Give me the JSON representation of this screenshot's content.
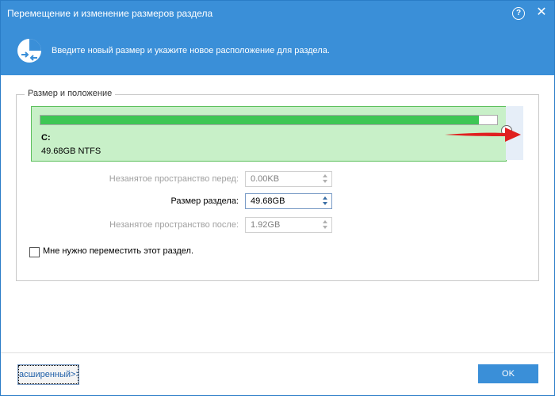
{
  "window": {
    "title": "Перемещение и изменение размеров раздела",
    "help_symbol": "?",
    "close_symbol": "✕"
  },
  "header": {
    "icon": "partition-move-icon",
    "instruction": "Введите новый размер и укажите новое расположение для раздела."
  },
  "group": {
    "title": "Размер и положение",
    "partition": {
      "drive": "C:",
      "info": "49.68GB NTFS",
      "used_fraction": 0.96
    },
    "fields": [
      {
        "label": "Незанятое пространство перед:",
        "value": "0.00KB",
        "enabled": false
      },
      {
        "label": "Размер раздела:",
        "value": "49.68GB",
        "enabled": true
      },
      {
        "label": "Незанятое пространство после:",
        "value": "1.92GB",
        "enabled": false
      }
    ],
    "move_checkbox": {
      "label": "Мне нужно переместить этот раздел.",
      "checked": false
    }
  },
  "footer": {
    "advanced_label": "асширенный>>",
    "ok_label": "OK"
  },
  "colors": {
    "accent": "#3a8fd8",
    "partition_fill": "#c8f0c8",
    "bar_fill": "#3ec654",
    "arrow": "#e02020"
  }
}
